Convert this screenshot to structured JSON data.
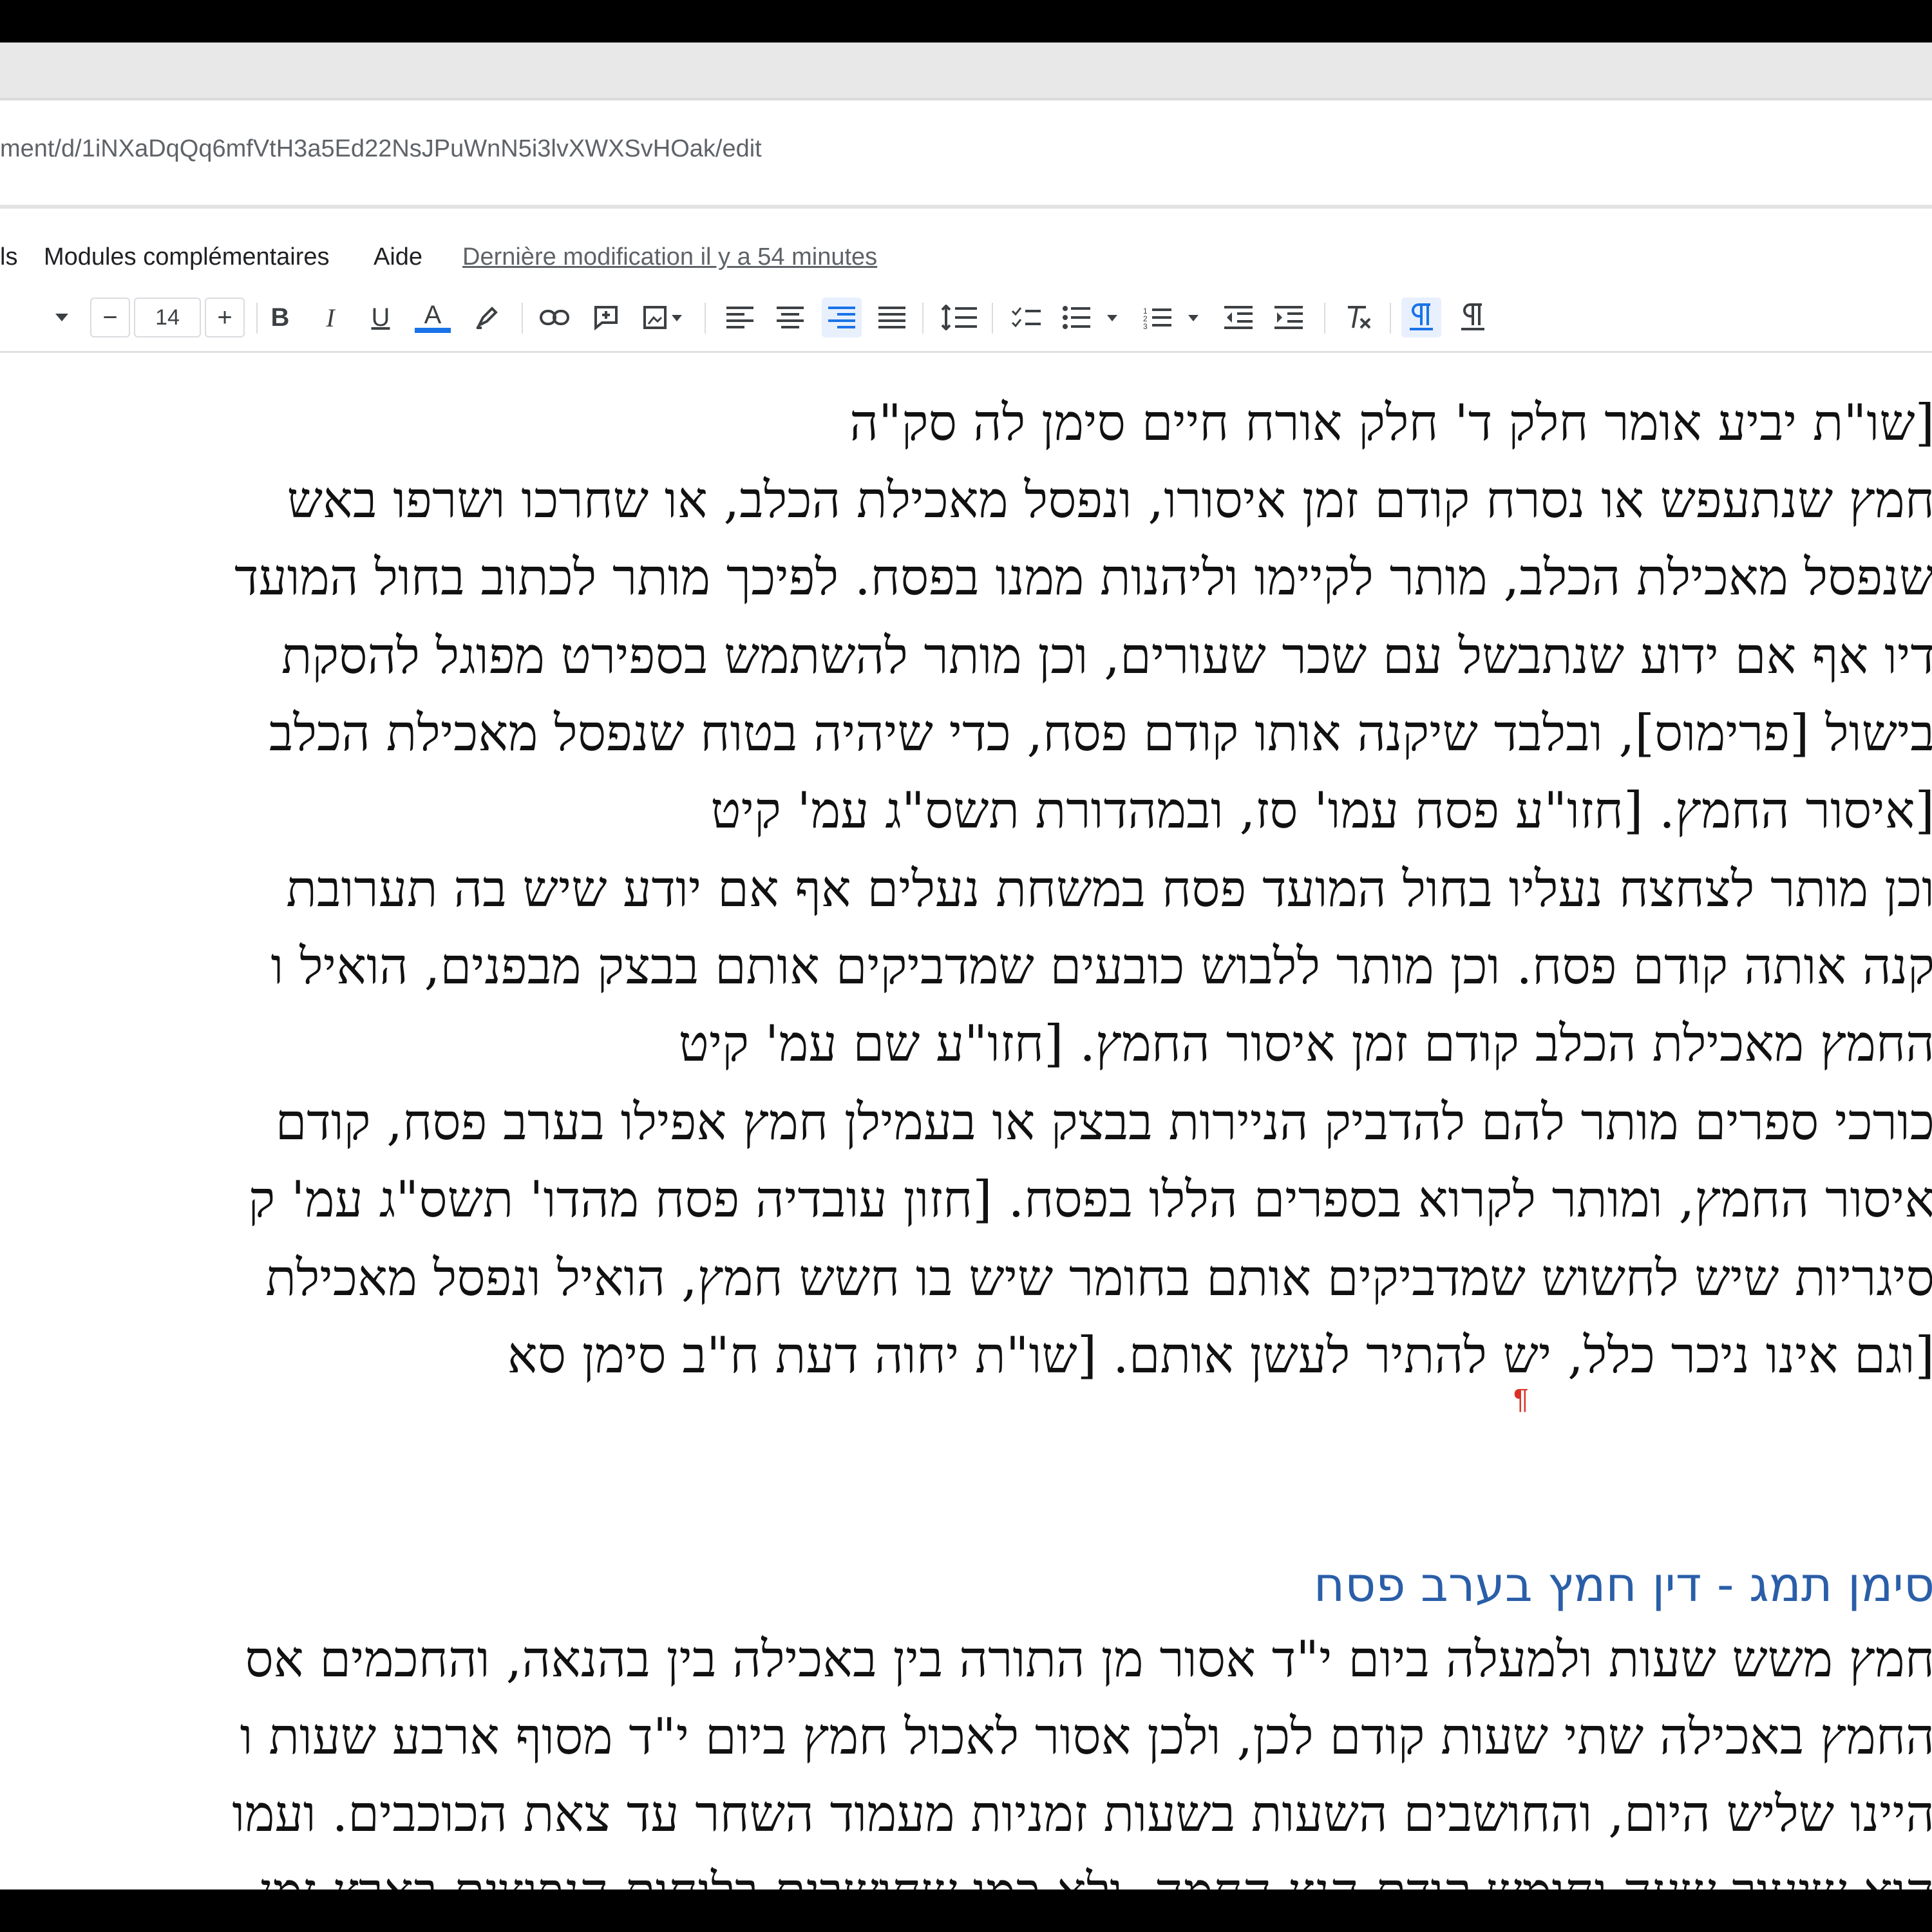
{
  "browser": {
    "url": "ment/d/1iNXaDqQq6mfVtH3a5Ed22NsJPuWnN5i3lvXWXSvHOak/edit"
  },
  "menu": {
    "items": [
      "ls",
      "Modules complémentaires",
      "Aide"
    ],
    "last_edit": "Dernière modification il y a 54 minutes"
  },
  "toolbar": {
    "font_size": "14",
    "decrease_label": "−",
    "increase_label": "+",
    "bold": "B",
    "italic": "I",
    "underline": "U",
    "text_color": "A",
    "colors": {
      "accent": "#1a73e8",
      "spelling": "#d93025",
      "heading": "#2a5ea8"
    }
  },
  "document": {
    "paragraph_mark": "¶",
    "lines": [
      "[שו\"ת יביע אומר חלק ד' חלק אורח חיים סימן לה סק\"ה",
      "חמץ שנתעפש או נסרח קודם זמן איסורו, ונפסל מאכילת הכלב, או שחרכו ושרפו באש",
      "שנפסל מאכילת הכלב, מותר לקיימו וליהנות ממנו בפסח. לפיכך מותר לכתוב בחול המועד",
      "דיו אף אם ידוע שנתבשל עם שכר שעורים, וכן מותר להשתמש בספירט מפוגל להסקת",
      "בישול [פרימוס], ובלבד שיקנה אותו קודם פסח, כדי שיהיה בטוח שנפסל מאכילת הכלב",
      "[איסור החמץ. [חזו\"ע פסח עמו' סז, ובמהדורת תשס\"ג עמ' קיט",
      "וכן מותר לצחצח נעליו בחול המועד פסח במשחת נעלים אף אם יודע שיש בה תערובת",
      "קנה אותה קודם פסח. וכן מותר ללבוש כובעים שמדביקים אותם בבצק מבפנים, הואיל ו",
      "החמץ מאכילת הכלב קודם זמן איסור החמץ. [חזו\"ע שם עמ' קיט",
      "כורכי ספרים מותר להם להדביק הניירות בבצק או בעמילן חמץ אפילו בערב פסח, קודם",
      "איסור החמץ, ומותר לקרוא בספרים הללו בפסח. [חזון עובדיה פסח מהדו' תשס\"ג עמ' ק",
      "סיגריות שיש לחשוש שמדביקים אותם בחומר שיש בו חשש חמץ, הואיל ונפסל מאכילת",
      "[וגם אינו ניכר כלל, יש להתיר לעשן אותם. [שו\"ת יחוה דעת ח\"ב סימן סא"
    ],
    "heading": "סימן תמג - דין חמץ בערב פסח",
    "lines2": [
      "חמץ משש שעות ולמעלה ביום י\"ד אסור מן התורה בין באכילה בין בהנאה, והחכמים אס",
      "החמץ באכילה שתי שעות קודם לכן, ולכן אסור לאכול חמץ ביום י\"ד מסוף ארבע שעות ו",
      "היינו שליש היום, והחושבים השעות בשעות זמניות מעמוד השחר עד צאת הכוכבים. ועמו",
      "הוא שיעור שעה וחומש קודם הנץ החמה, ולא כמו שחושבים בלוחות הנפוצים בארץ זמן"
    ]
  }
}
